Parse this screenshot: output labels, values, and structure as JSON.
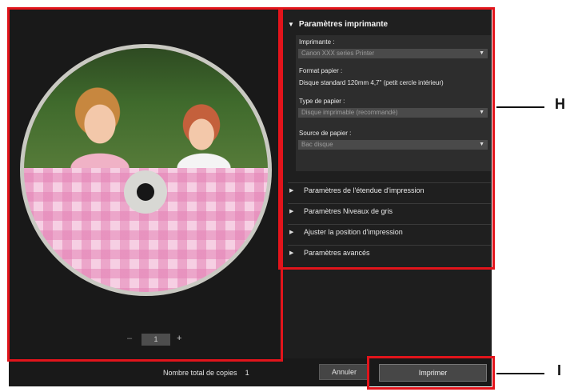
{
  "preview": {
    "pager": {
      "prev": "–",
      "page": "1",
      "next": "+"
    }
  },
  "printer_settings": {
    "section_title": "Paramètres imprimante",
    "printer_label": "Imprimante :",
    "printer_value": "Canon XXX series Printer",
    "paper_format_label": "Format papier :",
    "paper_format_value": "Disque standard 120mm 4,7\" (petit cercle intérieur)",
    "paper_type_label": "Type de papier :",
    "paper_type_value": "Disque imprimable (recommandé)",
    "paper_source_label": "Source de papier :",
    "paper_source_value": "Bac disque"
  },
  "collapsed_sections": [
    "Paramètres de l'étendue d'impression",
    "Paramètres Niveaux de gris",
    "Ajuster la position d'impression",
    "Paramètres avancés"
  ],
  "footer": {
    "copies_label": "Nombre total de copies",
    "copies_value": "1",
    "cancel_label": "Annuler",
    "print_label": "Imprimer"
  },
  "callouts": {
    "h": "H",
    "i": "I"
  },
  "colors": {
    "highlight": "#e2141b",
    "background": "#1e1e1e"
  }
}
